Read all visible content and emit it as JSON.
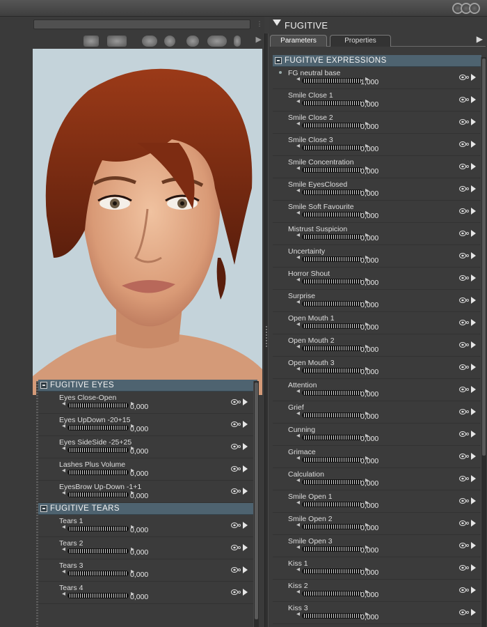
{
  "window": {
    "panel_title": "FUGITIVE",
    "tabs": [
      {
        "label": "Parameters",
        "active": true
      },
      {
        "label": "Properties",
        "active": false
      }
    ]
  },
  "colors": {
    "group_header": "#4e6370",
    "background": "#3b3b3b",
    "viewport_bg": "#c4d3da"
  },
  "icons": [
    "eye-icon",
    "link-icon",
    "play-icon",
    "minus-icon",
    "collapse-triangle-icon"
  ],
  "right_group": {
    "title": "FUGITIVE  EXPRESSIONS",
    "params": [
      {
        "label": "FG neutral base",
        "value": "1,000"
      },
      {
        "label": "Smile Close 1",
        "value": "0,000"
      },
      {
        "label": "Smile Close 2",
        "value": "0,000"
      },
      {
        "label": "Smile Close 3",
        "value": "0,000"
      },
      {
        "label": "Smile Concentration",
        "value": "0,000"
      },
      {
        "label": "Smile EyesClosed",
        "value": "0,000"
      },
      {
        "label": "Smile Soft Favourite",
        "value": "0,000"
      },
      {
        "label": "Mistrust Suspicion",
        "value": "0,000"
      },
      {
        "label": "Uncertainty",
        "value": "0,000"
      },
      {
        "label": "Horror Shout",
        "value": "0,000"
      },
      {
        "label": "Surprise",
        "value": "0,000"
      },
      {
        "label": "Open Mouth 1",
        "value": "0,000"
      },
      {
        "label": "Open Mouth 2",
        "value": "0,000"
      },
      {
        "label": "Open Mouth 3",
        "value": "0,000"
      },
      {
        "label": "Attention",
        "value": "0,000"
      },
      {
        "label": "Grief",
        "value": "0,000"
      },
      {
        "label": "Cunning",
        "value": "0,000"
      },
      {
        "label": "Grimace",
        "value": "0,000"
      },
      {
        "label": "Calculation",
        "value": "0,000"
      },
      {
        "label": "Smile Open 1",
        "value": "0,000"
      },
      {
        "label": "Smile Open 2",
        "value": "0,000"
      },
      {
        "label": "Smile Open 3",
        "value": "0,000"
      },
      {
        "label": "Kiss 1",
        "value": "0,000"
      },
      {
        "label": "Kiss 2",
        "value": "0,000"
      },
      {
        "label": "Kiss 3",
        "value": "0,000"
      }
    ]
  },
  "left_groups": [
    {
      "title": "FUGITIVE  EYES",
      "params": [
        {
          "label": "Eyes Close-Open",
          "value": "0,000"
        },
        {
          "label": "Eyes UpDown  -20+15",
          "value": "0,000"
        },
        {
          "label": "Eyes SideSide  -25+25",
          "value": "0,000"
        },
        {
          "label": "Lashes Plus Volume",
          "value": "0,000"
        },
        {
          "label": "EyesBrow Up-Down -1+1",
          "value": "0,000"
        }
      ]
    },
    {
      "title": "FUGITIVE  TEARS",
      "params": [
        {
          "label": "Tears 1",
          "value": "0,000"
        },
        {
          "label": "Tears 2",
          "value": "0,000"
        },
        {
          "label": "Tears 3",
          "value": "0,000"
        },
        {
          "label": "Tears 4",
          "value": "0,000"
        }
      ]
    }
  ]
}
